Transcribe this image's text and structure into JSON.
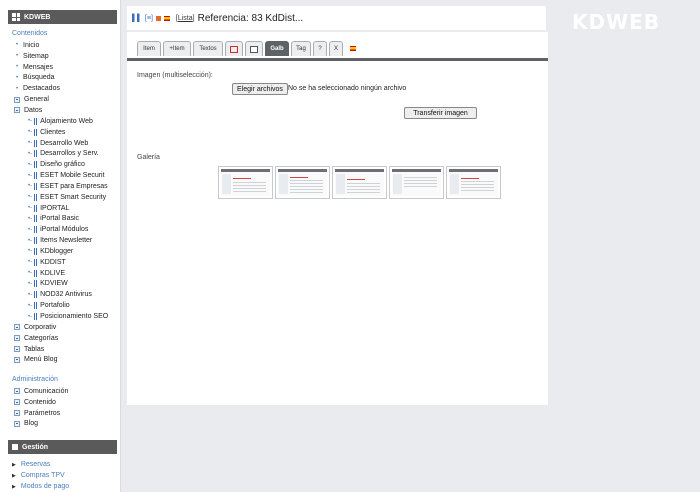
{
  "sidebar": {
    "header": "KDWEB",
    "contenidos_label": "Contenidos",
    "contenidos_items": [
      "Inicio",
      "Sitemap",
      "Mensajes",
      "Búsqueda",
      "Destacados"
    ],
    "general": "General",
    "datos": "Datos",
    "datos_items": [
      "Alojamiento Web",
      "Clientes",
      "Desarrollo Web",
      "Desarrollos y Serv.",
      "Diseño gráfico",
      "ESET Mobile Securit",
      "ESET para Empresas",
      "ESET Smart Security",
      "IPORTAL",
      "iPortal Basic",
      "iPortal Módulos",
      "Items Newsletter",
      "KDblogger",
      "KDDIST",
      "KDLIVE",
      "KDVIEW",
      "NOD32 Antivirus",
      "Portafolio",
      "Posicionamiento SEO"
    ],
    "after_items": [
      "Corporativ",
      "Categorías",
      "Tablas",
      "Menú Blog"
    ],
    "admin_label": "Administración",
    "admin_items": [
      "Comunicación",
      "Contenido",
      "Parámetros",
      "Blog"
    ],
    "gestion_header": "Gestión",
    "gestion_items": [
      "Reservas",
      "Compras TPV",
      "Modos de pago"
    ]
  },
  "titlebar": {
    "lista": "Lista",
    "title": "Referencia: 83 KdDist..."
  },
  "logo": "KDWEB",
  "tabs": [
    "Item",
    "+Item",
    "Textos",
    "Galb",
    "Tag",
    "?",
    "X"
  ],
  "upload": {
    "label": "Imagen (multiselección):",
    "choose_button": "Elegir archivos",
    "status": "No se ha seleccionado ningún archivo",
    "transfer_button": "Transferir imagen"
  },
  "gallery_label": "Galería",
  "accent": "#4a7ec0"
}
